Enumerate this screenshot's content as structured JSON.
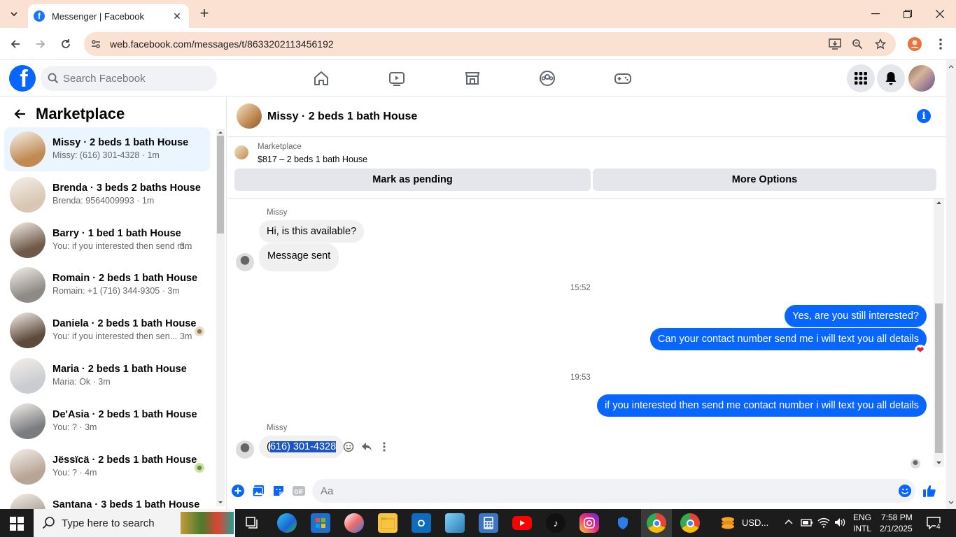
{
  "browser": {
    "tab_title": "Messenger | Facebook",
    "url": "web.facebook.com/messages/t/8633202113456192"
  },
  "fb": {
    "logo": "f",
    "search_placeholder": "Search Facebook",
    "nav_icons": [
      "home-icon",
      "watch-icon",
      "marketplace-icon",
      "groups-icon",
      "gaming-icon"
    ]
  },
  "sidebar": {
    "title": "Marketplace",
    "conversations": [
      {
        "name": "Missy · 2 beds 1 bath House",
        "preview": "Missy: (616) 301-4328 · 1m",
        "time": "",
        "active": true,
        "color": "#c08a52"
      },
      {
        "name": "Brenda · 3 beds 2 baths House",
        "preview": "Brenda: 9564009993 · 1m",
        "time": "",
        "active": false,
        "color": "#d9c7b3"
      },
      {
        "name": "Barry · 1 bed 1 bath House",
        "preview": "You: if you interested then send m...",
        "time": "3m",
        "active": false,
        "color": "#6f5a4a"
      },
      {
        "name": "Romain · 2 beds 1 bath House",
        "preview": "Romain: +1 (716) 344-9305 · 3m",
        "time": "",
        "active": false,
        "color": "#8e8a86"
      },
      {
        "name": "Daniela · 2 beds 1 bath House",
        "preview": "You: if you interested then sen...",
        "time": "3m",
        "active": false,
        "color": "#5d4a3c"
      },
      {
        "name": "Maria · 2 beds 1 bath House",
        "preview": "Maria: Ok · 3m",
        "time": "",
        "active": false,
        "color": "#c9ccd0"
      },
      {
        "name": "De'Asia · 2 beds 1 bath House",
        "preview": "You: ? · 3m",
        "time": "",
        "active": false,
        "color": "#7a7d80"
      },
      {
        "name": "Jëssïcä · 2 beds 1 bath House",
        "preview": "You: ? · 4m",
        "time": "",
        "active": false,
        "color": "#b7a595"
      },
      {
        "name": "Santana · 3 beds 1 bath House",
        "preview": "",
        "time": "",
        "active": false,
        "color": "#a59b90"
      }
    ]
  },
  "chat": {
    "title": "Missy · 2 beds 1 bath House",
    "listing_source": "Marketplace",
    "listing_price": "$817 – 2 beds 1 bath House",
    "btn_pending": "Mark as pending",
    "btn_more": "More Options",
    "sender1": "Missy",
    "msg1": "Hi, is this available?",
    "msg2": "Message sent",
    "time1": "15:52",
    "out1": "Yes, are you still interested?",
    "out2": "Can your contact number send me i will text you all details",
    "time2": "19:53",
    "out3": "if you interested then send me contact number i will text you all details",
    "sender2": "Missy",
    "msg3_first": "(",
    "msg3_sel": "616) 301-4328",
    "composer_placeholder": "Aa"
  },
  "taskbar": {
    "search_placeholder": "Type here to search",
    "currency": "USD...",
    "lang1": "ENG",
    "lang2": "INTL",
    "time": "7:58 PM",
    "date": "2/1/2025",
    "notif_count": "4"
  }
}
